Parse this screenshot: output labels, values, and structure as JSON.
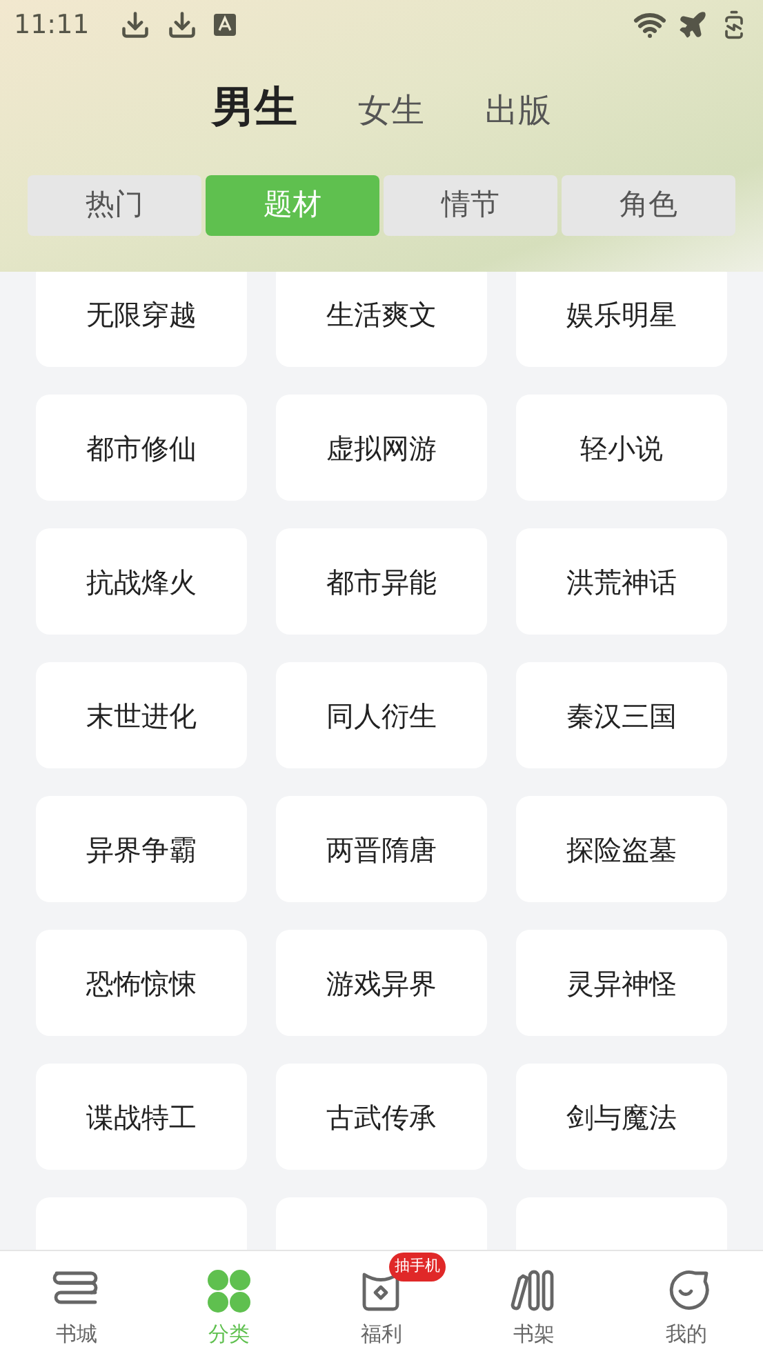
{
  "status_bar": {
    "time": "11:11"
  },
  "gender_tabs": [
    {
      "label": "男生",
      "selected": true
    },
    {
      "label": "女生",
      "selected": false
    },
    {
      "label": "出版",
      "selected": false
    }
  ],
  "category_tabs": [
    {
      "label": "热门",
      "selected": false
    },
    {
      "label": "题材",
      "selected": true
    },
    {
      "label": "情节",
      "selected": false
    },
    {
      "label": "角色",
      "selected": false
    }
  ],
  "categories": [
    "无限穿越",
    "生活爽文",
    "娱乐明星",
    "都市修仙",
    "虚拟网游",
    "轻小说",
    "抗战烽火",
    "都市异能",
    "洪荒神话",
    "末世进化",
    "同人衍生",
    "秦汉三国",
    "异界争霸",
    "两晋隋唐",
    "探险盗墓",
    "恐怖惊悚",
    "游戏异界",
    "灵异神怪",
    "谍战特工",
    "古武传承",
    "剑与魔法"
  ],
  "bottom_nav": [
    {
      "kind": "bookstore",
      "label": "书城",
      "selected": false
    },
    {
      "kind": "categories",
      "label": "分类",
      "selected": true
    },
    {
      "kind": "rewards",
      "label": "福利",
      "selected": false,
      "badge": "抽手机"
    },
    {
      "kind": "shelf",
      "label": "书架",
      "selected": false
    },
    {
      "kind": "profile",
      "label": "我的",
      "selected": false
    }
  ]
}
